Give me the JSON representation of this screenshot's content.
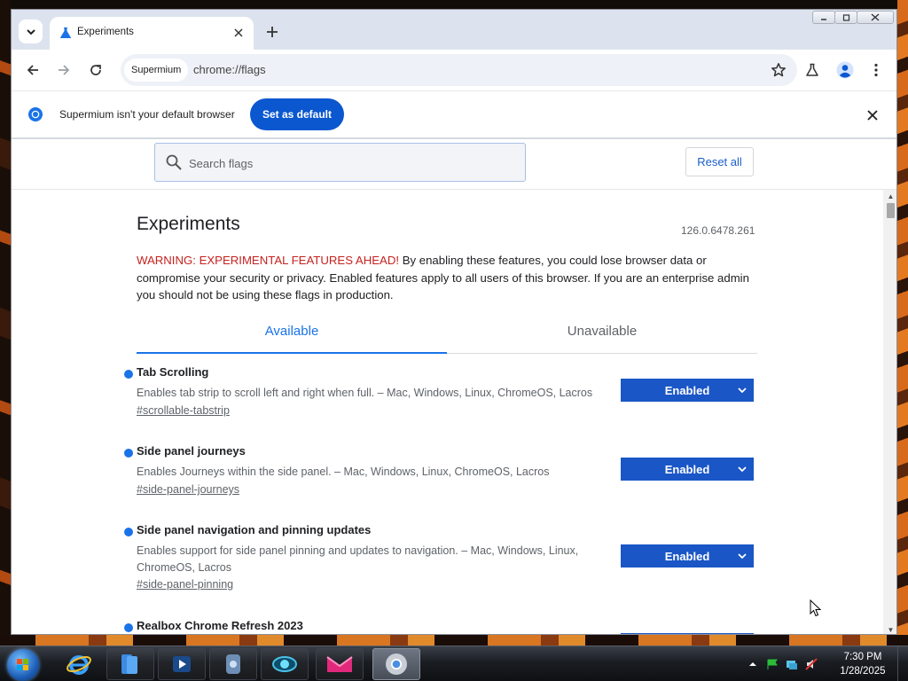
{
  "browser": {
    "tab_title": "Experiments",
    "omnibox_chip": "Supermium",
    "url": "chrome://flags"
  },
  "infobar": {
    "message": "Supermium isn't your default browser",
    "set_default_label": "Set as default"
  },
  "search": {
    "placeholder": "Search flags",
    "reset_label": "Reset all"
  },
  "page": {
    "title": "Experiments",
    "version": "126.0.6478.261",
    "warning_prefix": "WARNING: EXPERIMENTAL FEATURES AHEAD!",
    "warning_body": " By enabling these features, you could lose browser data or compromise your security or privacy. Enabled features apply to all users of this browser. If you are an enterprise admin you should not be using these flags in production.",
    "tabs": [
      "Available",
      "Unavailable"
    ],
    "flags": [
      {
        "name": "Tab Scrolling",
        "description": "Enables tab strip to scroll left and right when full. – Mac, Windows, Linux, ChromeOS, Lacros",
        "link": "#scrollable-tabstrip",
        "state": "Enabled"
      },
      {
        "name": "Side panel journeys",
        "description": "Enables Journeys within the side panel. – Mac, Windows, Linux, ChromeOS, Lacros",
        "link": "#side-panel-journeys",
        "state": "Enabled"
      },
      {
        "name": "Side panel navigation and pinning updates",
        "description": "Enables support for side panel pinning and updates to navigation. – Mac, Windows, Linux, ChromeOS, Lacros",
        "link": "#side-panel-pinning",
        "state": "Enabled"
      },
      {
        "name": "Realbox Chrome Refresh 2023",
        "description": "",
        "link": "",
        "state": ""
      }
    ]
  },
  "taskbar": {
    "time": "7:30 PM",
    "date": "1/28/2025"
  },
  "colors": {
    "accent_blue": "#1a73e8",
    "button_blue": "#0b57d0",
    "select_blue": "#1a56c6",
    "warning_red": "#c5221f"
  },
  "icons": [
    "tab-search-icon",
    "flask-icon",
    "close-icon",
    "new-tab-icon",
    "back-icon",
    "forward-icon",
    "reload-icon",
    "star-icon",
    "labs-icon",
    "profile-icon",
    "menu-icon",
    "chromium-icon",
    "search-icon",
    "chevron-down-icon",
    "start-icon",
    "ie-icon",
    "cursor-icon"
  ]
}
